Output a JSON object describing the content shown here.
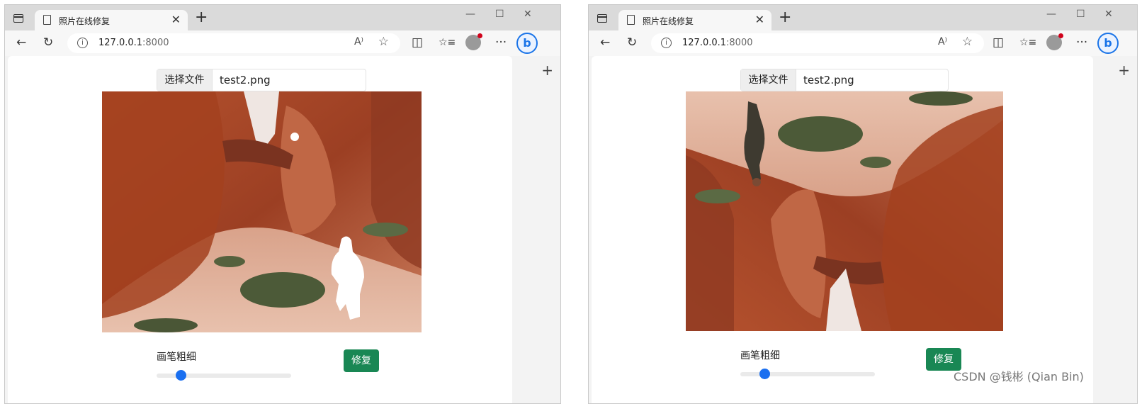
{
  "left_window": {
    "tab_title": "照片在线修复",
    "url_host": "127.0.0.1",
    "url_port": ":8000",
    "file_button": "选择文件",
    "file_name": "test2.png",
    "brush_label": "画笔粗细",
    "repair_button": "修复",
    "brush_size": 0.18
  },
  "right_window": {
    "tab_title": "照片在线修复",
    "url_host": "127.0.0.1",
    "url_port": ":8000",
    "file_button": "选择文件",
    "file_name": "test2.png",
    "brush_label": "画笔粗细",
    "repair_button": "修复",
    "brush_size": 0.18
  },
  "browser_ui": {
    "close_glyph": "✕",
    "new_tab_glyph": "+",
    "minimize_glyph": "—",
    "maximize_glyph": "☐",
    "window_close_glyph": "✕",
    "back_glyph": "←",
    "reload_glyph": "↻",
    "read_aloud_glyph": "A⁾",
    "favorite_glyph": "☆",
    "split_glyph": "◫",
    "favorites_list_glyph": "☆≡",
    "more_glyph": "···",
    "info_glyph": "i",
    "bing_glyph": "b",
    "side_plus_glyph": "+"
  },
  "watermark": "CSDN @钱彬 (Qian Bin)",
  "colors": {
    "accent_blue": "#1a6ff0",
    "repair_green": "#198754",
    "rock_red": "#a4452a"
  }
}
